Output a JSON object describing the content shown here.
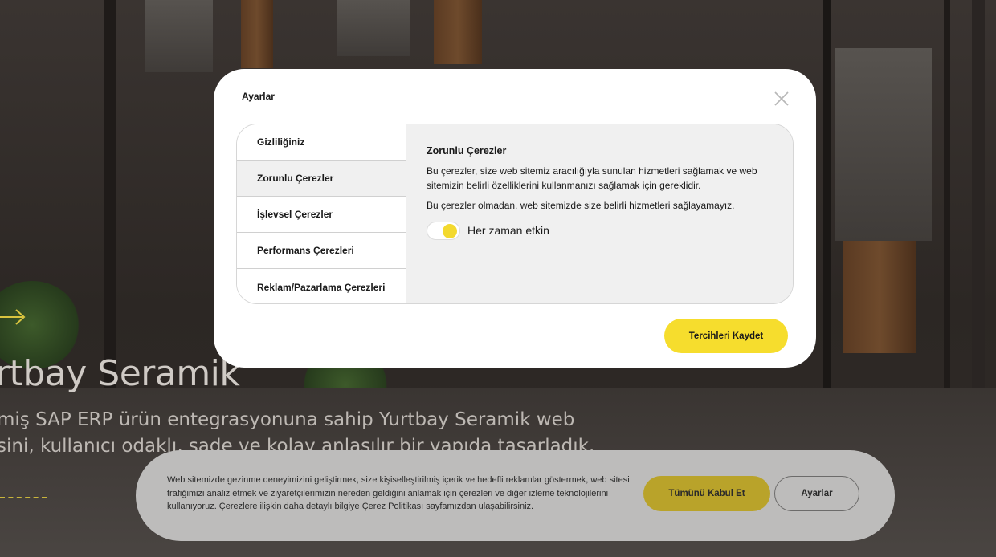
{
  "hero": {
    "title": "rtbay Seramik",
    "desc_line1": "miş SAP ERP ürün entegrasyonuna sahip Yurtbay Seramik web",
    "desc_line2": "sini, kullanıcı odaklı, sade ve kolay anlaşılır bir yapıda tasarladık."
  },
  "cookie_banner": {
    "text_before_link": "Web sitemizde gezinme deneyimizini geliştirmek, size kişiselleştirilmiş içerik ve hedefli reklamlar göstermek, web sitesi trafiğimizi analiz etmek ve ziyaretçilerimizin nereden geldiğini anlamak için çerezleri ve diğer izleme teknolojilerini kullanıyoruz. Çerezlere ilişkin daha detaylı bilgiye ",
    "link_label": "Çerez Politikası",
    "text_after_link": " sayfamızdan ulaşabilirsiniz.",
    "accept_all_label": "Tümünü Kabul Et",
    "settings_label": "Ayarlar"
  },
  "modal": {
    "title": "Ayarlar",
    "close_icon": "close-icon",
    "tabs": [
      {
        "label": "Gizliliğiniz"
      },
      {
        "label": "Zorunlu Çerezler"
      },
      {
        "label": "İşlevsel Çerezler"
      },
      {
        "label": "Performans Çerezleri"
      },
      {
        "label": "Reklam/Pazarlama Çerezleri"
      }
    ],
    "active_tab": 1,
    "content": {
      "heading": "Zorunlu Çerezler",
      "paragraph1": "Bu çerezler, size web sitemiz aracılığıyla sunulan hizmetleri sağlamak ve web sitemizin belirli özelliklerini kullanmanızı sağlamak için gereklidir.",
      "paragraph2": "Bu çerezler olmadan, web sitemizde size belirli hizmetleri sağlayamayız.",
      "toggle_label": "Her zaman etkin",
      "toggle_on": true
    },
    "save_label": "Tercihleri Kaydet"
  },
  "colors": {
    "accent": "#f6dd2d",
    "accent_dimmed": "#b9a32a",
    "panel_bg": "#f0f0f0"
  }
}
